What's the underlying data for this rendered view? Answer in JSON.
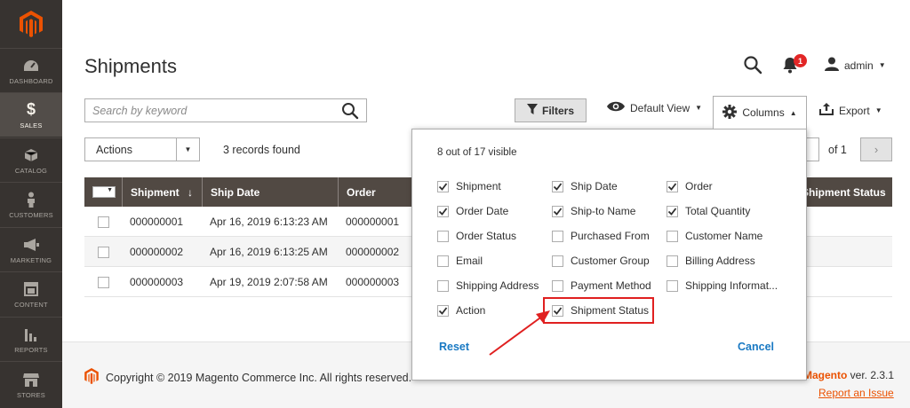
{
  "sidebar": {
    "items": [
      {
        "label": "DASHBOARD",
        "icon": "dashboard-icon"
      },
      {
        "label": "SALES",
        "icon": "dollar-icon",
        "active": true
      },
      {
        "label": "CATALOG",
        "icon": "cube-icon"
      },
      {
        "label": "CUSTOMERS",
        "icon": "person-icon"
      },
      {
        "label": "MARKETING",
        "icon": "megaphone-icon"
      },
      {
        "label": "CONTENT",
        "icon": "layout-icon"
      },
      {
        "label": "REPORTS",
        "icon": "bar-chart-icon"
      },
      {
        "label": "STORES",
        "icon": "store-icon"
      }
    ]
  },
  "header": {
    "title": "Shipments",
    "notifications_count": "1",
    "user": "admin"
  },
  "search": {
    "placeholder": "Search by keyword"
  },
  "toolbar": {
    "filters": "Filters",
    "default_view": "Default View",
    "columns": "Columns",
    "export": "Export",
    "actions": "Actions",
    "records_found": "3 records found",
    "page_of": "of 1"
  },
  "grid": {
    "headers": [
      "Shipment",
      "Ship Date",
      "Order",
      "Shipment Status"
    ],
    "sort_indicator": "↓",
    "rows": [
      {
        "shipment": "000000001",
        "ship_date": "Apr 16, 2019 6:13:23 AM",
        "order": "000000001"
      },
      {
        "shipment": "000000002",
        "ship_date": "Apr 16, 2019 6:13:25 AM",
        "order": "000000002"
      },
      {
        "shipment": "000000003",
        "ship_date": "Apr 19, 2019 2:07:58 AM",
        "order": "000000003"
      }
    ]
  },
  "columns_panel": {
    "count": "8 out of 17 visible",
    "options": [
      {
        "label": "Shipment",
        "checked": true
      },
      {
        "label": "Ship Date",
        "checked": true
      },
      {
        "label": "Order",
        "checked": true
      },
      {
        "label": "Order Date",
        "checked": true
      },
      {
        "label": "Ship-to Name",
        "checked": true
      },
      {
        "label": "Total Quantity",
        "checked": true
      },
      {
        "label": "Order Status",
        "checked": false
      },
      {
        "label": "Purchased From",
        "checked": false
      },
      {
        "label": "Customer Name",
        "checked": false
      },
      {
        "label": "Email",
        "checked": false
      },
      {
        "label": "Customer Group",
        "checked": false
      },
      {
        "label": "Billing Address",
        "checked": false
      },
      {
        "label": "Shipping Address",
        "checked": false
      },
      {
        "label": "Payment Method",
        "checked": false
      },
      {
        "label": "Shipping Informat...",
        "checked": false
      },
      {
        "label": "Action",
        "checked": true
      },
      {
        "label": "Shipment Status",
        "checked": true
      }
    ],
    "reset": "Reset",
    "cancel": "Cancel"
  },
  "footer": {
    "copyright": "Copyright © 2019 Magento Commerce Inc. All rights reserved.",
    "brand": "Magento",
    "version": " ver. 2.3.1",
    "report_issue": "Report an Issue"
  },
  "colors": {
    "sidebar_bg": "#373330",
    "accent_orange": "#eb5202",
    "grid_header_bg": "#514943",
    "link_blue": "#1979c3",
    "annotation_red": "#e02020"
  }
}
